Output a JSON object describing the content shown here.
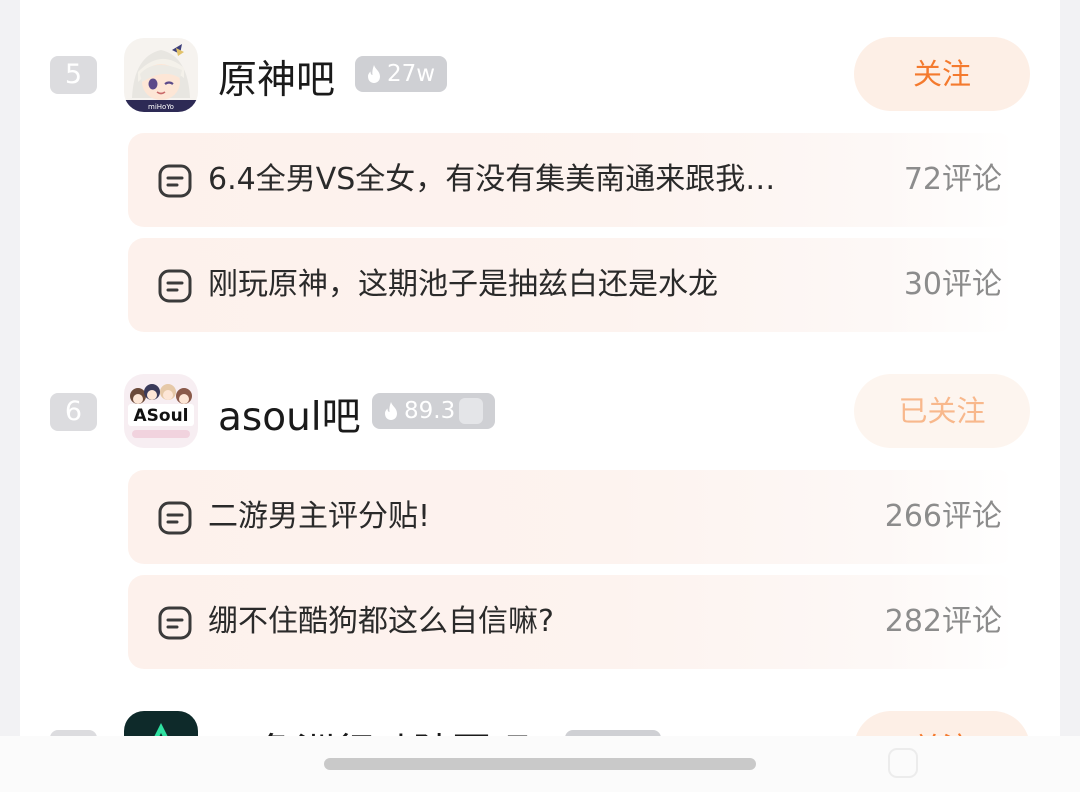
{
  "forums": [
    {
      "rank": "5",
      "name": "原神吧",
      "heat": "27w",
      "follow_label": "关注",
      "followed": false,
      "avatar_icon": "genshin-avatar",
      "posts": [
        {
          "title": "6.4全男VS全女，有没有集美南通来跟我…",
          "comments": "72评论"
        },
        {
          "title": "刚玩原神，这期池子是抽兹白还是水龙",
          "comments": "30评论"
        }
      ]
    },
    {
      "rank": "6",
      "name": "asoul吧",
      "heat": "89.3",
      "follow_label": "已关注",
      "followed": true,
      "avatar_icon": "asoul-avatar",
      "avatar_text": "ASoul",
      "posts": [
        {
          "title": "二游男主评分贴!",
          "comments": "266评论"
        },
        {
          "title": "绷不住酷狗都这么自信嘛?",
          "comments": "282评论"
        }
      ]
    },
    {
      "rank": "",
      "name": "三角洲行动陆军吧",
      "heat": "",
      "follow_label": "关注",
      "followed": false,
      "avatar_icon": "delta-force-avatar"
    }
  ],
  "colors": {
    "accent": "#f47a2e",
    "followed_text": "#f8b88c",
    "badge_bg": "#dcdcdf",
    "post_bg": "#fdf1ec"
  }
}
